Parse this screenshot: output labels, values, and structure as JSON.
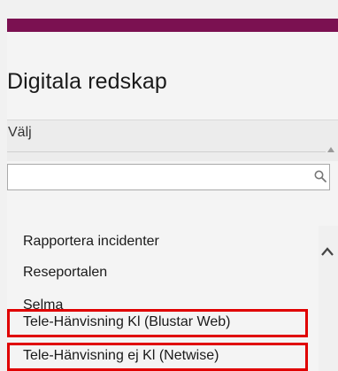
{
  "header": {
    "title": "Digitala redskap"
  },
  "select": {
    "label": "Välj",
    "search_placeholder": ""
  },
  "list": {
    "items": [
      {
        "label": "Rapportera incidenter"
      },
      {
        "label": "Reseportalen"
      },
      {
        "label": "Selma"
      },
      {
        "label": "Tele-Hänvisning Kl (Blustar Web)",
        "highlighted": true
      },
      {
        "label": "Tele-Hänvisning ej Kl (Netwise)",
        "highlighted": true
      }
    ]
  },
  "icons": {
    "search": "search-icon",
    "scroll_up": "chevron-up-icon",
    "small_up": "triangle-up-icon"
  },
  "colors": {
    "brand_bar": "#7b1151",
    "highlight_border": "#e00000",
    "background": "#f4f4f4"
  }
}
